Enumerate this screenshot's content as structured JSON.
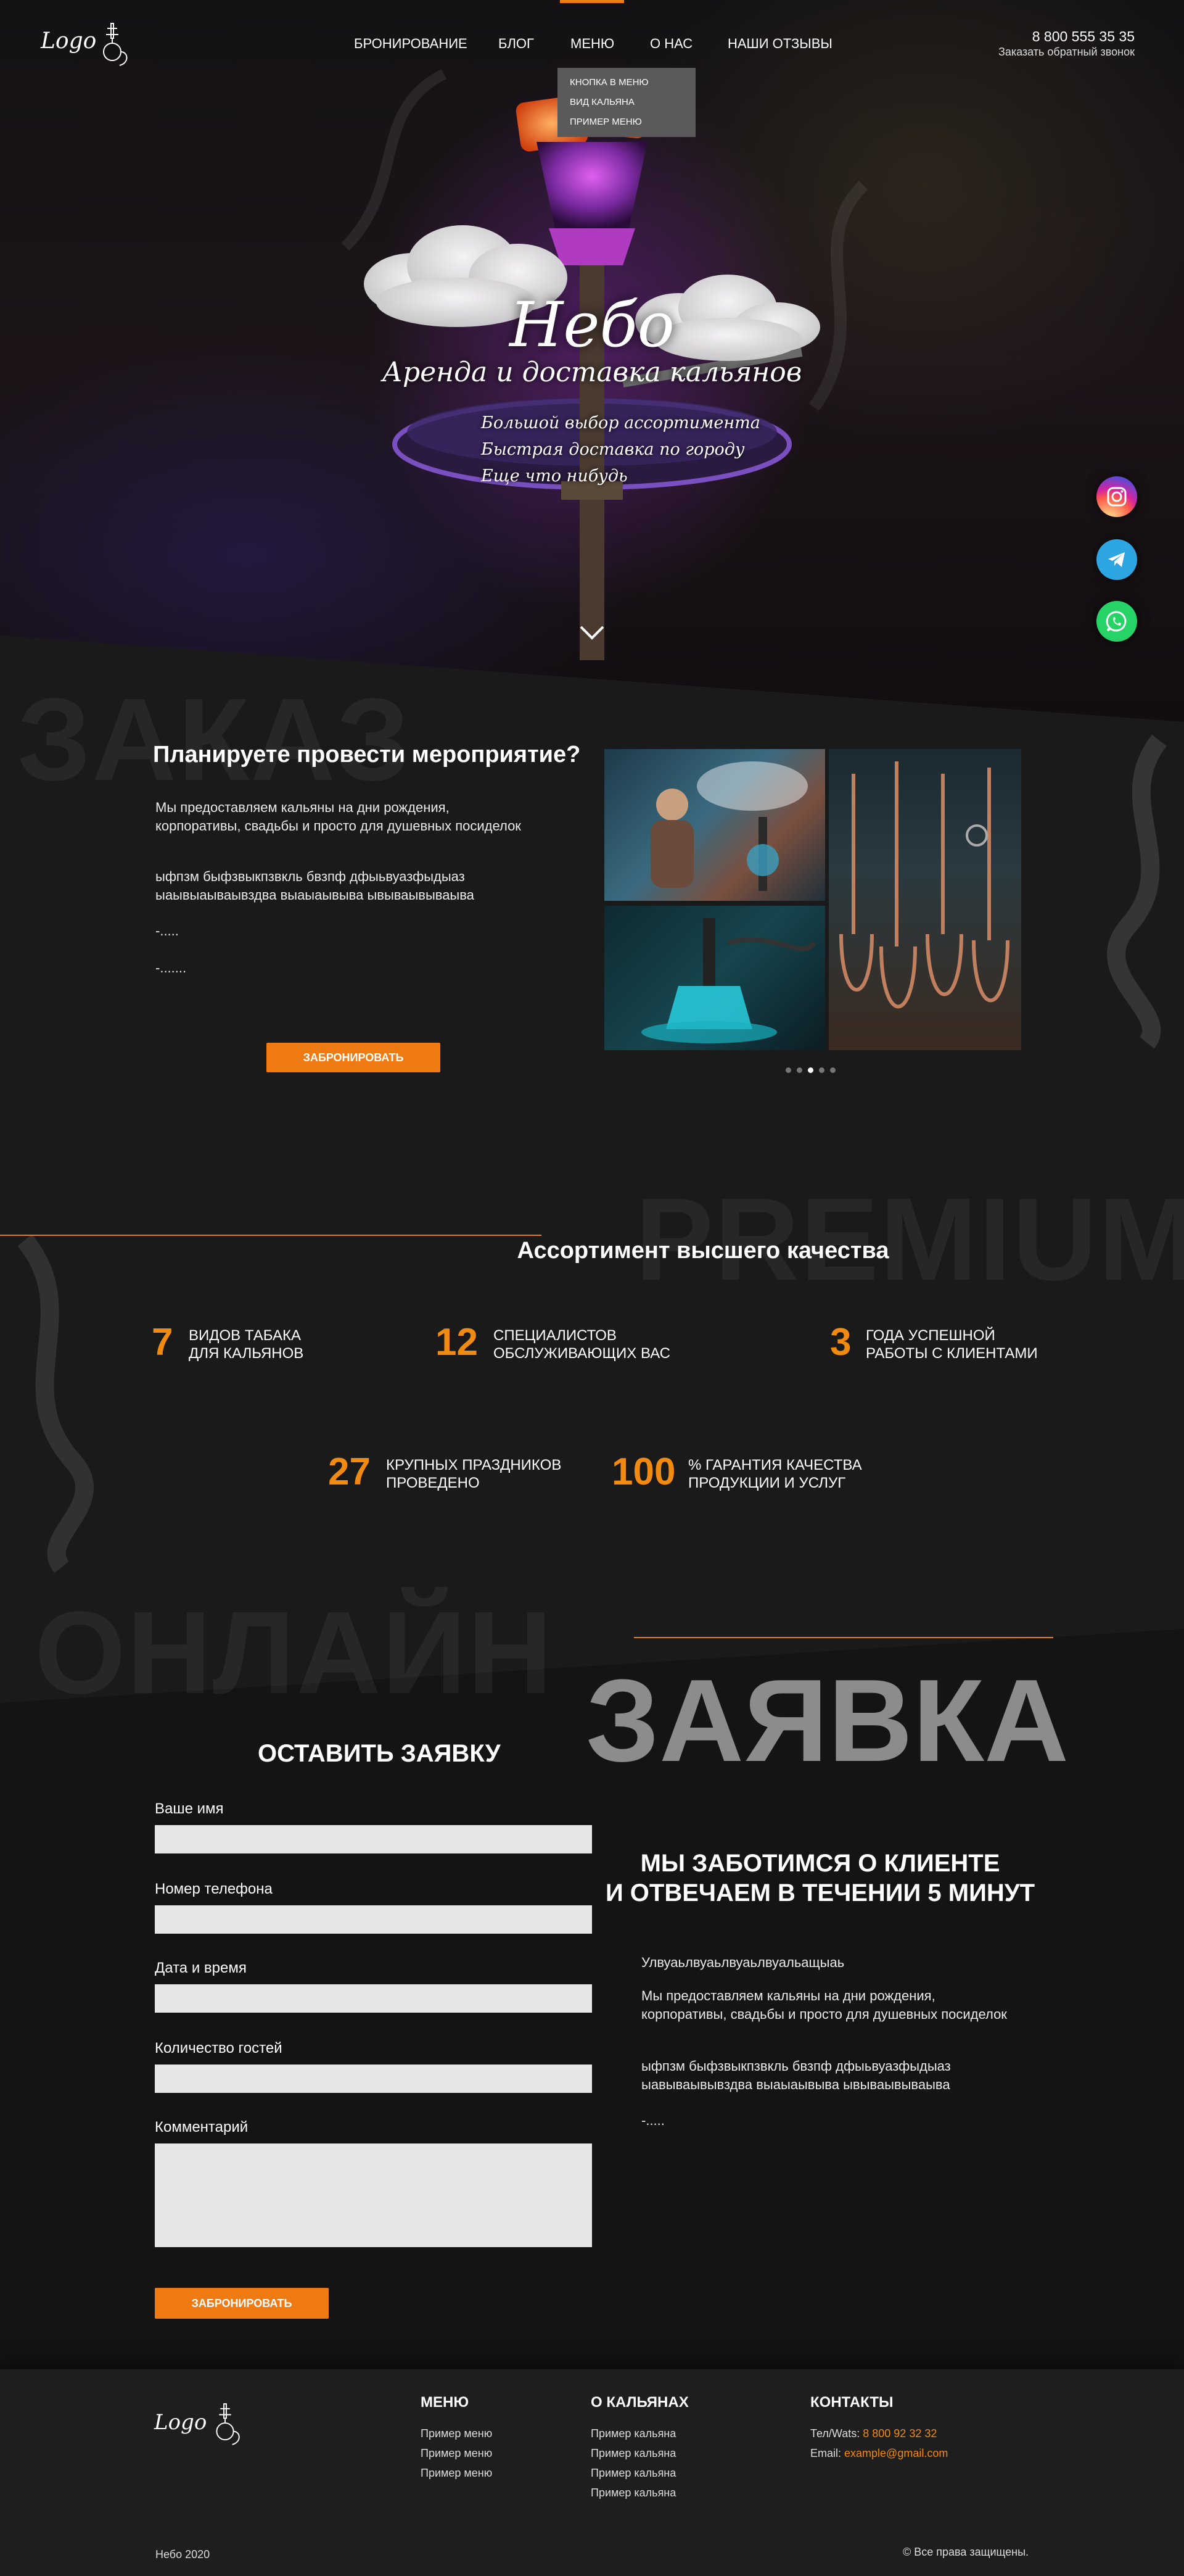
{
  "nav": {
    "logo": "Logo",
    "items": [
      "БРОНИРОВАНИЕ",
      "БЛОГ",
      "МЕНЮ",
      "О НАС",
      "НАШИ ОТЗЫВЫ"
    ],
    "dropdown": [
      "КНОПКА В МЕНЮ",
      "ВИД КАЛЬЯНА",
      "ПРИМЕР МЕНЮ"
    ],
    "phone": "8 800 555 35 35",
    "callback": "Заказать обратный звонок"
  },
  "hero": {
    "title": "Небо",
    "subtitle": "Аренда и доставка кальянов",
    "features": [
      "Большой выбор ассортимента",
      "Быстрая доставка по городу",
      "Еще что нибудь"
    ]
  },
  "social": [
    "instagram-icon",
    "telegram-icon",
    "whatsapp-icon"
  ],
  "event": {
    "watermark": "ЗАКАЗ",
    "title": "Планируете провести мероприятие?",
    "p1": "Мы предоставляем кальяны на дни рождения, корпоративы, свадьбы и просто для душевных посиделок",
    "p2": "ыфпзм быфзвыкпзвкль  бвзпф дфыьвуазфыдыаз ыаывыаываывздва выаыаывыва ывываывываыва",
    "p3": "-.....",
    "p4": "-.......",
    "button": "ЗАБРОНИРОВАТЬ"
  },
  "premium": {
    "watermark": "PREMIUM",
    "title": "Ассортимент высшего качества",
    "stats": [
      {
        "num": "7",
        "label1": "ВИДОВ ТАБАКА",
        "label2": "ДЛЯ КАЛЬЯНОВ"
      },
      {
        "num": "12",
        "label1": "СПЕЦИАЛИСТОВ",
        "label2": "ОБСЛУЖИВАЮЩИХ ВАС"
      },
      {
        "num": "3",
        "label1": "ГОДА УСПЕШНОЙ",
        "label2": "РАБОТЫ С КЛИЕНТАМИ"
      },
      {
        "num": "27",
        "label1": "КРУПНЫХ ПРАЗДНИКОВ",
        "label2": "ПРОВЕДЕНО"
      },
      {
        "num": "100",
        "label1": "% ГАРАНТИЯ КАЧЕСТВА",
        "label2": "ПРОДУКЦИИ И УСЛУГ"
      }
    ]
  },
  "order": {
    "watermark": "ОНЛАЙН",
    "big": "ЗАЯВКА",
    "form_title": "ОСТАВИТЬ ЗАЯВКУ",
    "fields": [
      "Ваше имя",
      "Номер телефона",
      "Дата и время",
      "Количество гостей",
      "Комментарий"
    ],
    "button": "ЗАБРОНИРОВАТЬ",
    "care_title1": "МЫ ЗАБОТИМСЯ О КЛИЕНТЕ",
    "care_title2": "И ОТВЕЧАЕМ В ТЕЧЕНИИ 5 МИНУТ",
    "care_p1": "Улвуаьлвуаьлвуаьлвуальащыаь",
    "care_p2": "Мы предоставляем кальяны на дни рождения, корпоративы, свадьбы и просто для душевных посиделок",
    "care_p3": "ыфпзм быфзвыкпзвкль  бвзпф дфыьвуазфыдыаз ыавываывывздва выаыаывыва ывываывываыва",
    "care_p4": "-....."
  },
  "footer": {
    "logo": "Logo",
    "menu_head": "МЕНЮ",
    "menu_items": [
      "Пример меню",
      "Пример меню",
      "Пример меню"
    ],
    "hookah_head": "О КАЛЬЯНАХ",
    "hookah_items": [
      "Пример кальяна",
      "Пример кальяна",
      "Пример кальяна",
      "Пример кальяна"
    ],
    "contacts_head": "КОНТАКТЫ",
    "tel_label": "Тел/Wats: ",
    "tel": "8 800 92 32 32",
    "email_label": "Email: ",
    "email": "example@gmail.com",
    "copyright_left": "Небо 2020",
    "copyright_right": "© Все права защищены."
  },
  "colors": {
    "accent": "#f07a12",
    "background": "#1a1a1a",
    "input": "#e6e6e6"
  }
}
